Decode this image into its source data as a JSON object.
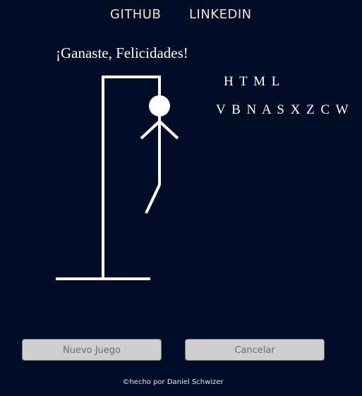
{
  "nav": {
    "github_label": "GITHUB",
    "linkedin_label": "LINKEDIN"
  },
  "game": {
    "status_message": "¡Ganaste, Felicidades!",
    "word": "H T M L",
    "wrong_letters": "V B N A S X Z C W"
  },
  "buttons": {
    "new_game_label": "Nuevo Juego",
    "cancel_label": "Cancelar"
  },
  "footer": {
    "credit": "©hecho por Daniel Schwizer"
  },
  "colors": {
    "background": "#000b26",
    "nav_text": "#f2e3c6",
    "drawing": "#ffffff",
    "button_bg": "#cfcfcf"
  }
}
